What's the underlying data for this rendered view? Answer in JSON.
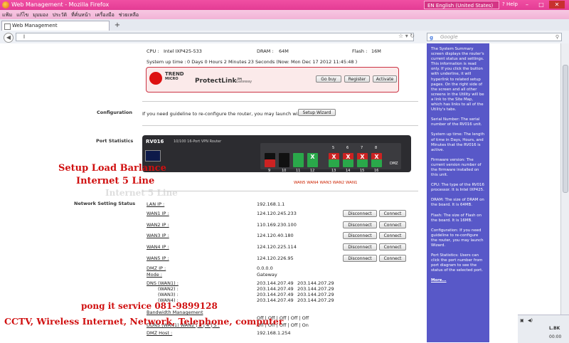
{
  "window": {
    "title": "Web Management - Mozilla Firefox",
    "language": "EN English (United States)",
    "help": "Help"
  },
  "menu": [
    "แฟ้ม",
    "แก้ไข",
    "มุมมอง",
    "ประวัติ",
    "ที่คั่นหน้า",
    "เครื่องมือ",
    "ช่วยเหลือ"
  ],
  "tab": {
    "title": "Web Management",
    "new_tab": "+"
  },
  "nav": {
    "url": "l",
    "search_placeholder": "Google"
  },
  "system": {
    "cpu_label": "CPU :",
    "cpu_value": "Intel IXP425-533",
    "dram_label": "DRAM :",
    "dram_value": "64M",
    "flash_label": "Flash :",
    "flash_value": "16M",
    "uptime_label": "System up time :",
    "uptime_value": "0 Days 0 Hours 2 Minutes 23 Seconds   (Now: Mon Dec 17 2012 11:45:48 )"
  },
  "trend": {
    "brand": "TREND",
    "sub": "MICRO",
    "product": "ProtectLink™",
    "gateway": "Gateway",
    "go_buy": "Go buy",
    "register": "Register",
    "activate": "Activate"
  },
  "configuration": {
    "label": "Configuration",
    "text": "If you need guideline to re-configure the router, you may launch wizard.",
    "button": "Setup Wizard"
  },
  "port_statistics": {
    "label": "Port Statistics",
    "model": "RV016",
    "model_sub": "10/100 16-Port VPN Router",
    "top_ports": [
      "",
      "",
      "",
      "X",
      "X",
      "X",
      "X",
      "X"
    ],
    "bottom_numbers": [
      "9",
      "10",
      "11",
      "12",
      "13",
      "14",
      "15",
      "16"
    ],
    "top_numbers": [
      "",
      "",
      "",
      "",
      "5",
      "6",
      "7",
      "8"
    ],
    "wan_labels": "WAN5  WAN4  WAN3 WAN2 WAN1",
    "dmz_label": "DMZ"
  },
  "network": {
    "label": "Network Setting Status",
    "lan_ip_label": "LAN IP :",
    "lan_ip": "192.168.1.1",
    "wans": [
      {
        "label": "WAN1 IP :",
        "ip": "124.120.245.233"
      },
      {
        "label": "WAN2 IP :",
        "ip": "110.169.230.100"
      },
      {
        "label": "WAN3 IP :",
        "ip": "124.120.40.180"
      },
      {
        "label": "WAN4 IP :",
        "ip": "124.120.225.114"
      },
      {
        "label": "WAN5 IP :",
        "ip": "124.120.226.95"
      }
    ],
    "disconnect": "Disconnect",
    "connect": "Connect",
    "dmz_ip_label": "DMZ IP :",
    "dmz_ip": "0.0.0.0",
    "mode_label": "Mode :",
    "mode": "Gateway",
    "dns_label": "DNS (WAN1) :",
    "dns_rows": [
      {
        "label": "(WAN2) :",
        "a": "203.144.207.49",
        "b": "203.144.207.29"
      },
      {
        "label": "(WAN3) :",
        "a": "203.144.207.49",
        "b": "203.144.207.29"
      },
      {
        "label": "(WAN4) :",
        "a": "203.144.207.49",
        "b": "203.144.207.29"
      }
    ],
    "dns_wan1_a": "203.144.207.49",
    "dns_wan1_b": "203.144.207.29",
    "bandwidth_label": "Bandwidth Management",
    "ddns_label": "DDNS (WAN1) WAN2 | 3 | 4 | 5 :",
    "off_row": "Off    |    Off    |    Off    |    Off    |    Off",
    "on_row": "Off    |    Off    |    Off    |    Off    |    On",
    "dmz_host_label": "DMZ Host :",
    "dmz_host": "192.168.1.254"
  },
  "help_panel": [
    "The System Summary screen displays the router's current status and settings. This information is read only. If you click the button with underline, it will hyperlink to related setup pages. On the right side of the screen and all other screens in the Utility will be a link to the Site Map, which has links to all of the Utility's tabs.",
    "Serial Number: The serial number of the RV016 unit.",
    "System up time: The length of time in Days, Hours, and Minutes that the RV016 is active.",
    "Firmware version: The current version number of the firmware installed on this unit.",
    "CPU: The type of the RV016 processor. It is Intel IXP425.",
    "DRAM: The size of DRAM on the board. It is 64MB.",
    "Flash: The size of Flash on the board. It is 16MB.",
    "Configuration: If you need guideline to re-configure the router, you may launch Wizard.",
    "Port Statistics: Users can click the port number from port diagram to see the status of the selected port."
  ],
  "help_more": "More...",
  "overlay": {
    "line1": "Setup Load Barlance",
    "line2": "Internet 5 Line",
    "ghost": "Internet 5 Line",
    "pong": "pong it service 081-9899128",
    "cctv": "CCTV, Wireless Internet, Network, Telephone, computer"
  },
  "tray": {
    "a": "L.BK",
    "b": "00:00"
  },
  "colors": {
    "titlebar": "#e43c94",
    "help_bg": "#5858c8",
    "overlay_red": "#d01010",
    "wan_red": "#cc2222",
    "port_green": "#2aa84a"
  }
}
